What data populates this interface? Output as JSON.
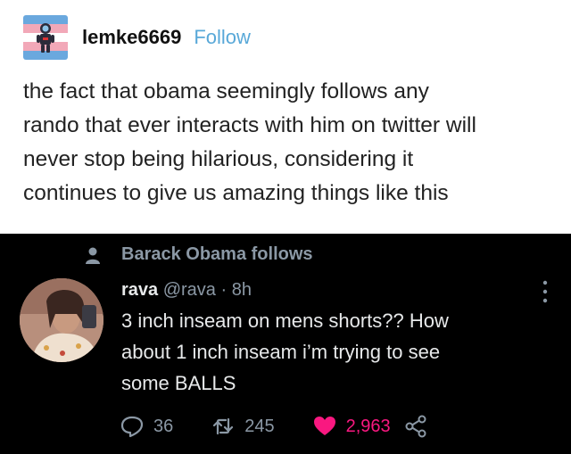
{
  "post": {
    "username": "lemke6669",
    "follow_label": "Follow",
    "text_lines": [
      "the fact that obama seemingly follows any",
      "rando that ever interacts with him on twitter will",
      "never stop being hilarious, considering it",
      "continues to give us amazing things like this"
    ]
  },
  "tweet": {
    "context": "Barack Obama follows",
    "name": "rava",
    "handle": "@rava",
    "separator": "·",
    "time": "8h",
    "text_lines": [
      "3 inch inseam on mens shorts?? How",
      "about 1 inch inseam i’m trying to see",
      "some BALLS"
    ],
    "replies": "36",
    "retweets": "245",
    "likes": "2,963"
  },
  "colors": {
    "follow": "#58a8d8",
    "like": "#f91880",
    "muted": "#8b98a5",
    "tweet_bg": "#000000"
  },
  "icons": [
    "astronaut-avatar",
    "person-icon",
    "more-icon",
    "reply-icon",
    "retweet-icon",
    "heart-icon",
    "share-icon"
  ]
}
